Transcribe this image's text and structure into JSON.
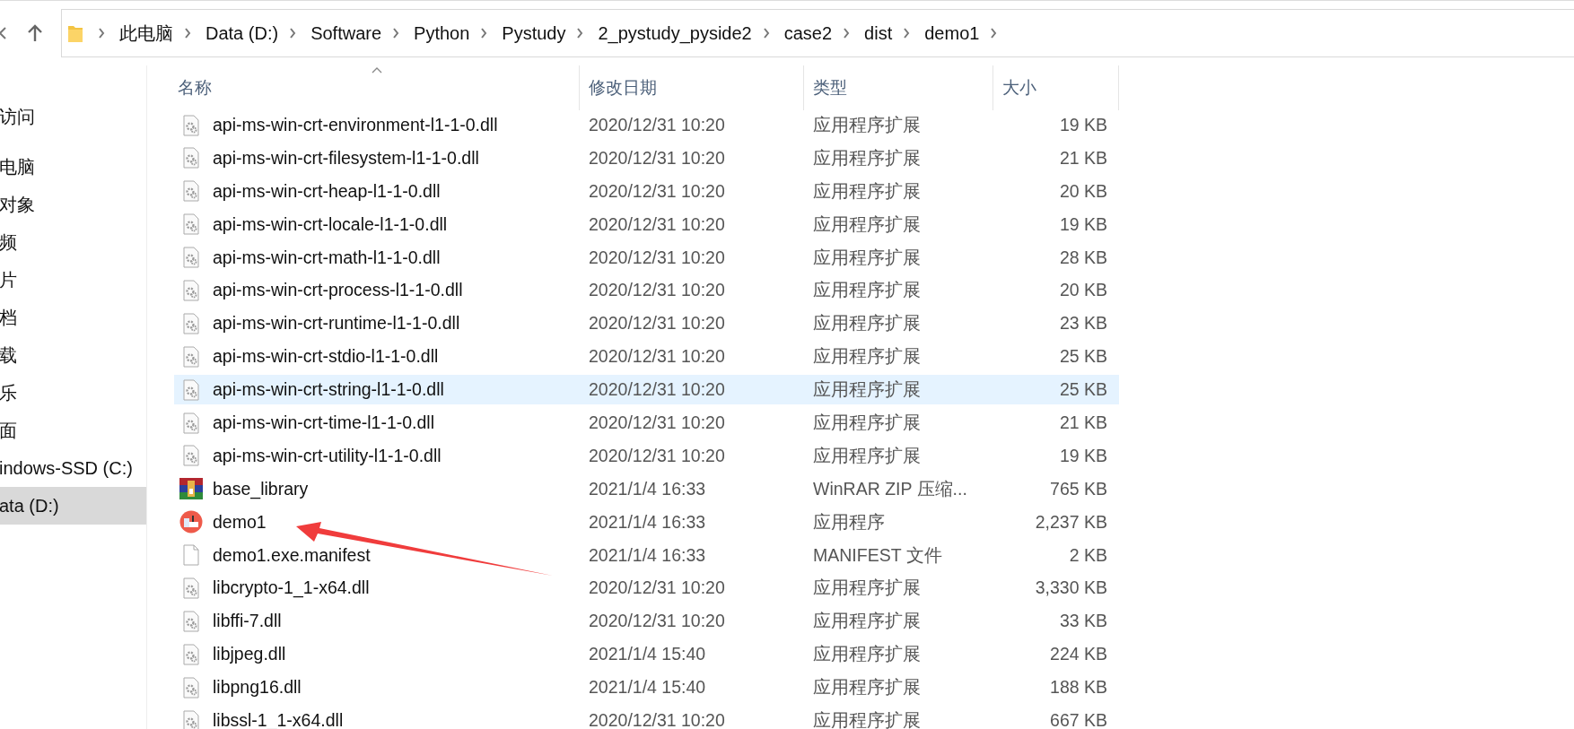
{
  "address_bar": {
    "breadcrumbs": [
      "此电脑",
      "Data (D:)",
      "Software",
      "Python",
      "Pystudy",
      "2_pystudy_pyside2",
      "case2",
      "dist",
      "demo1"
    ]
  },
  "navigation_pane": {
    "items": [
      {
        "label": "访问",
        "selected": false
      },
      {
        "label": "电脑",
        "selected": false
      },
      {
        "label": "对象",
        "selected": false
      },
      {
        "label": "频",
        "selected": false
      },
      {
        "label": "片",
        "selected": false
      },
      {
        "label": "档",
        "selected": false
      },
      {
        "label": "载",
        "selected": false
      },
      {
        "label": "乐",
        "selected": false
      },
      {
        "label": "面",
        "selected": false
      },
      {
        "label": "indows-SSD (C:)",
        "selected": false
      },
      {
        "label": "ata (D:)",
        "selected": true
      }
    ]
  },
  "file_list": {
    "columns": [
      {
        "label": "名称",
        "sorted": true
      },
      {
        "label": "修改日期",
        "sorted": false
      },
      {
        "label": "类型",
        "sorted": false
      },
      {
        "label": "大小",
        "sorted": false
      }
    ],
    "rows": [
      {
        "kind": "dll",
        "name": "api-ms-win-crt-environment-l1-1-0.dll",
        "modified": "2020/12/31 10:20",
        "type": "应用程序扩展",
        "size": "19 KB",
        "selected": false
      },
      {
        "kind": "dll",
        "name": "api-ms-win-crt-filesystem-l1-1-0.dll",
        "modified": "2020/12/31 10:20",
        "type": "应用程序扩展",
        "size": "21 KB",
        "selected": false
      },
      {
        "kind": "dll",
        "name": "api-ms-win-crt-heap-l1-1-0.dll",
        "modified": "2020/12/31 10:20",
        "type": "应用程序扩展",
        "size": "20 KB",
        "selected": false
      },
      {
        "kind": "dll",
        "name": "api-ms-win-crt-locale-l1-1-0.dll",
        "modified": "2020/12/31 10:20",
        "type": "应用程序扩展",
        "size": "19 KB",
        "selected": false
      },
      {
        "kind": "dll",
        "name": "api-ms-win-crt-math-l1-1-0.dll",
        "modified": "2020/12/31 10:20",
        "type": "应用程序扩展",
        "size": "28 KB",
        "selected": false
      },
      {
        "kind": "dll",
        "name": "api-ms-win-crt-process-l1-1-0.dll",
        "modified": "2020/12/31 10:20",
        "type": "应用程序扩展",
        "size": "20 KB",
        "selected": false
      },
      {
        "kind": "dll",
        "name": "api-ms-win-crt-runtime-l1-1-0.dll",
        "modified": "2020/12/31 10:20",
        "type": "应用程序扩展",
        "size": "23 KB",
        "selected": false
      },
      {
        "kind": "dll",
        "name": "api-ms-win-crt-stdio-l1-1-0.dll",
        "modified": "2020/12/31 10:20",
        "type": "应用程序扩展",
        "size": "25 KB",
        "selected": false
      },
      {
        "kind": "dll",
        "name": "api-ms-win-crt-string-l1-1-0.dll",
        "modified": "2020/12/31 10:20",
        "type": "应用程序扩展",
        "size": "25 KB",
        "selected": true
      },
      {
        "kind": "dll",
        "name": "api-ms-win-crt-time-l1-1-0.dll",
        "modified": "2020/12/31 10:20",
        "type": "应用程序扩展",
        "size": "21 KB",
        "selected": false
      },
      {
        "kind": "dll",
        "name": "api-ms-win-crt-utility-l1-1-0.dll",
        "modified": "2020/12/31 10:20",
        "type": "应用程序扩展",
        "size": "19 KB",
        "selected": false
      },
      {
        "kind": "archive",
        "name": "base_library",
        "modified": "2021/1/4 16:33",
        "type": "WinRAR ZIP 压缩...",
        "size": "765 KB",
        "selected": false
      },
      {
        "kind": "app",
        "name": "demo1",
        "modified": "2021/1/4 16:33",
        "type": "应用程序",
        "size": "2,237 KB",
        "selected": false
      },
      {
        "kind": "file",
        "name": "demo1.exe.manifest",
        "modified": "2021/1/4 16:33",
        "type": "MANIFEST 文件",
        "size": "2 KB",
        "selected": false
      },
      {
        "kind": "dll",
        "name": "libcrypto-1_1-x64.dll",
        "modified": "2020/12/31 10:20",
        "type": "应用程序扩展",
        "size": "3,330 KB",
        "selected": false
      },
      {
        "kind": "dll",
        "name": "libffi-7.dll",
        "modified": "2020/12/31 10:20",
        "type": "应用程序扩展",
        "size": "33 KB",
        "selected": false
      },
      {
        "kind": "dll",
        "name": "libjpeg.dll",
        "modified": "2021/1/4 15:40",
        "type": "应用程序扩展",
        "size": "224 KB",
        "selected": false
      },
      {
        "kind": "dll",
        "name": "libpng16.dll",
        "modified": "2021/1/4 15:40",
        "type": "应用程序扩展",
        "size": "188 KB",
        "selected": false
      },
      {
        "kind": "dll",
        "name": "libssl-1_1-x64.dll",
        "modified": "2020/12/31 10:20",
        "type": "应用程序扩展",
        "size": "667 KB",
        "selected": false
      }
    ]
  }
}
